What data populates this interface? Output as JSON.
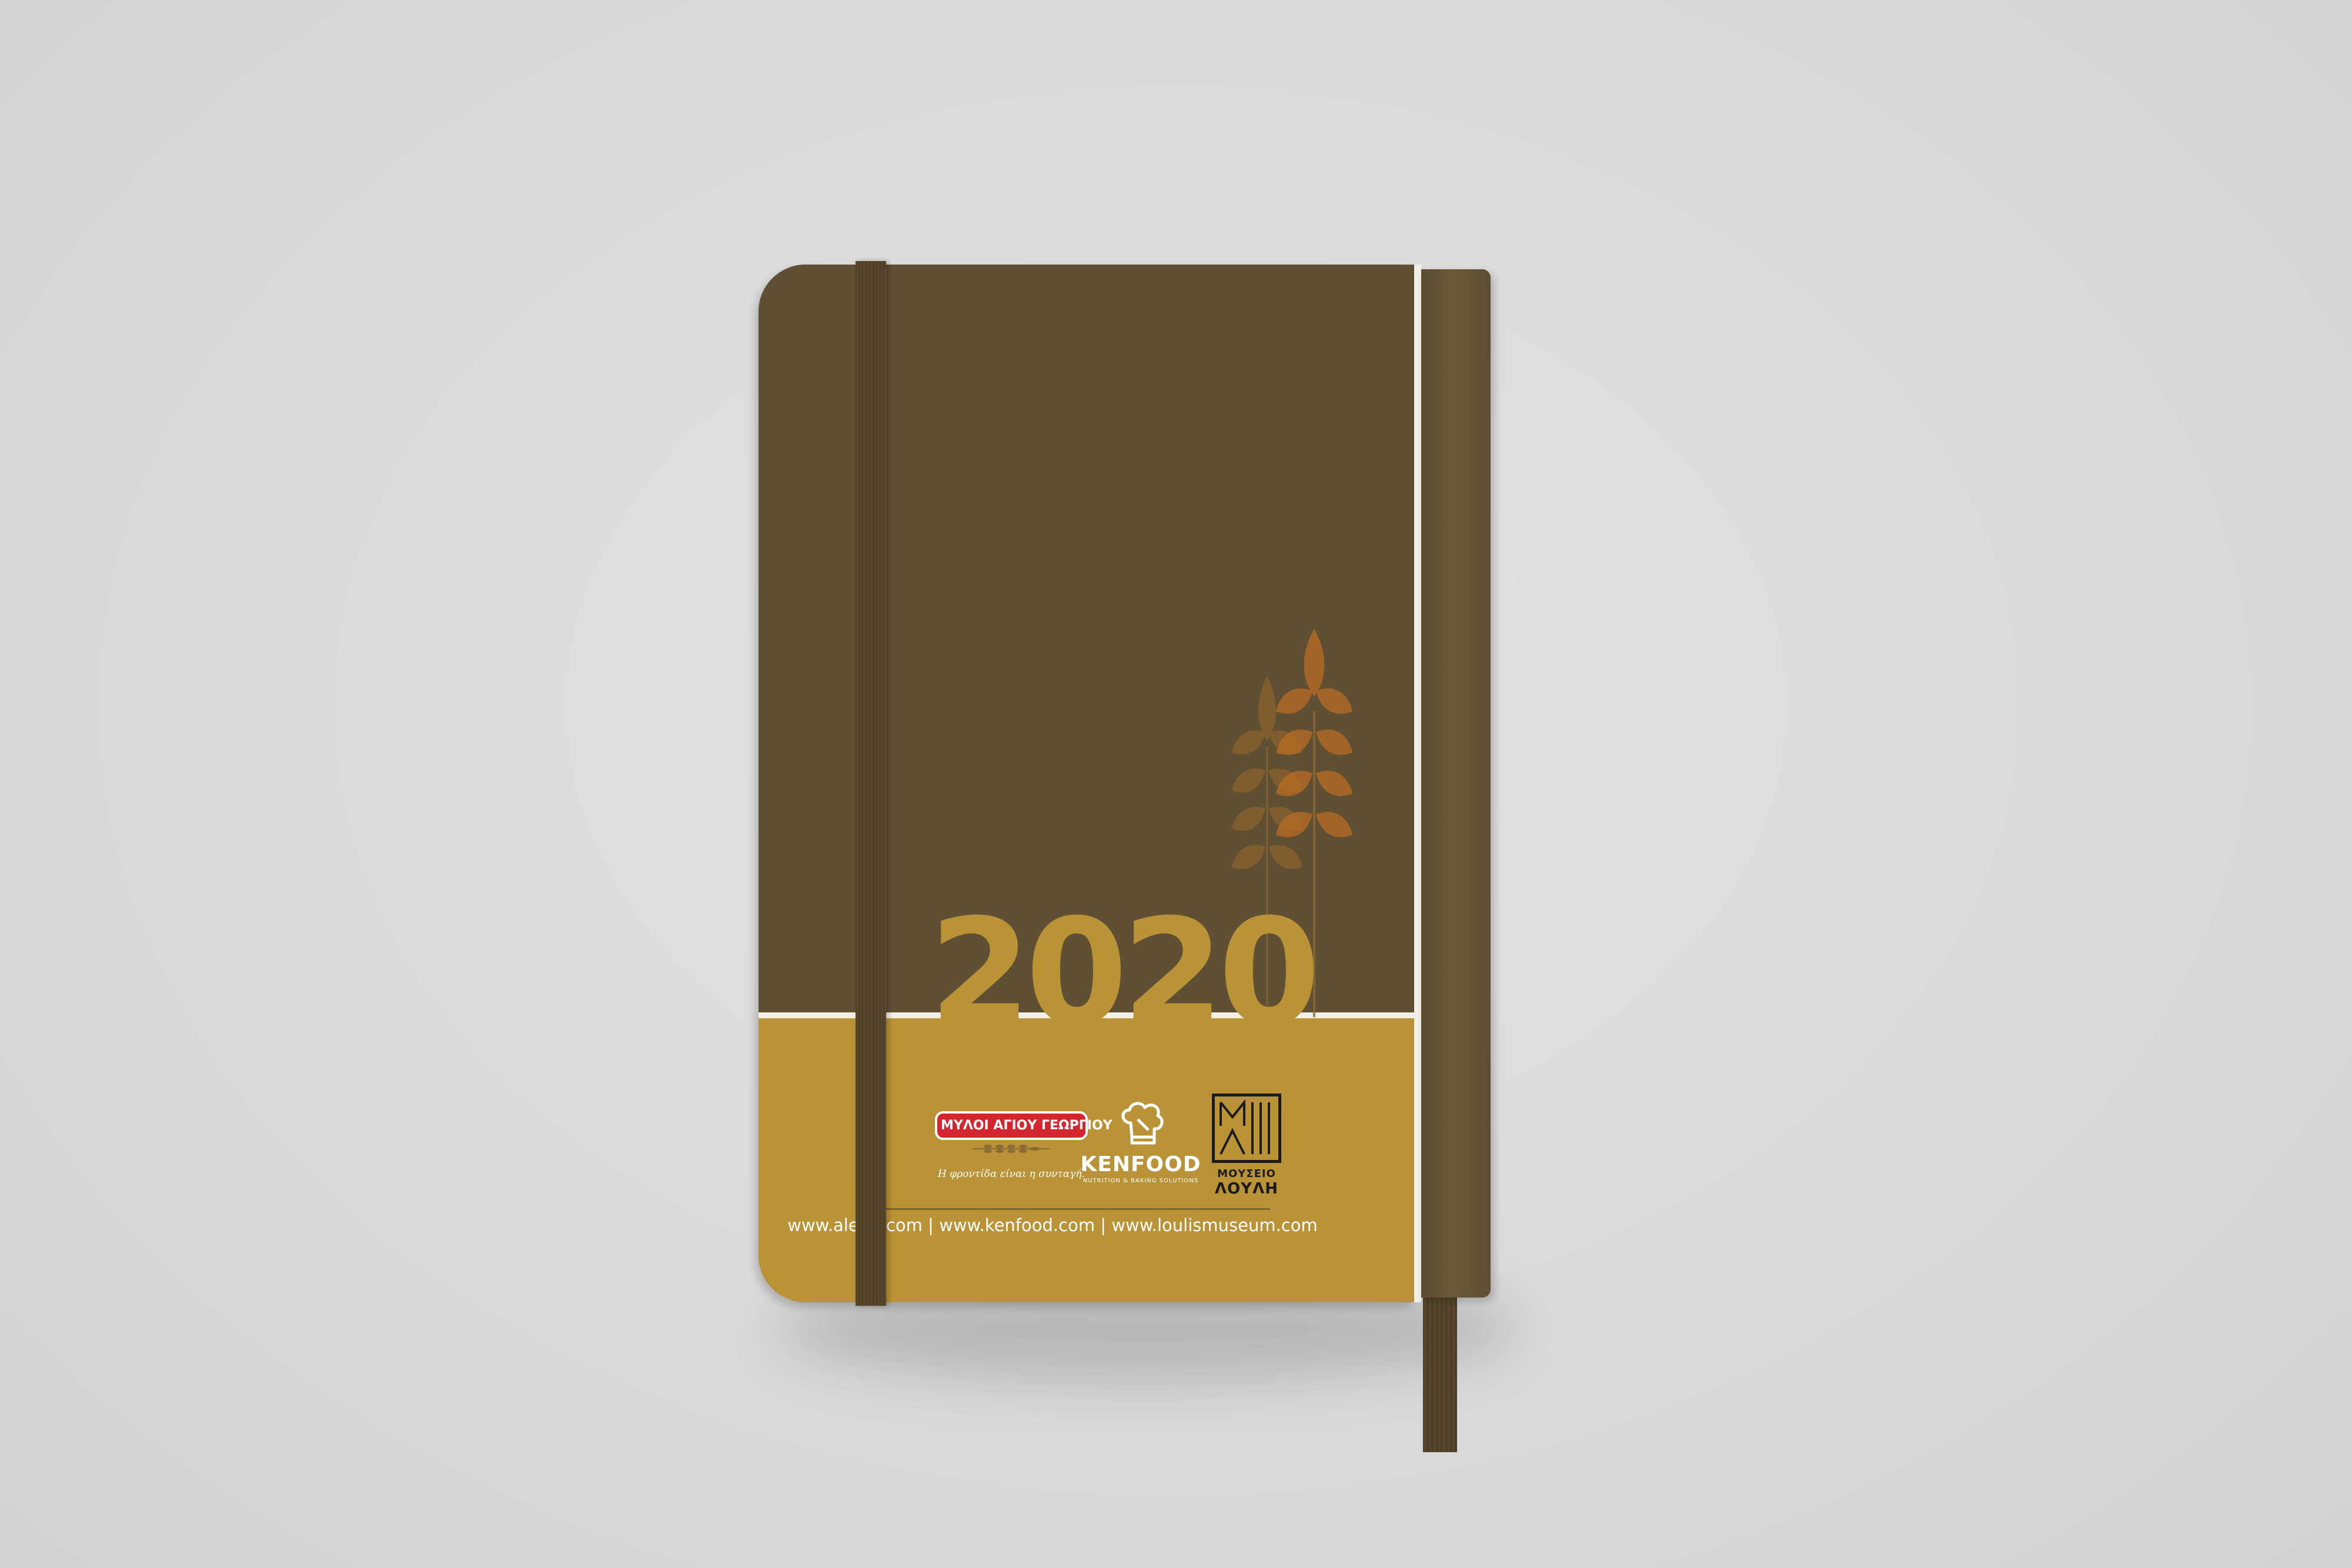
{
  "cover": {
    "year": "2020",
    "colors": {
      "cover_brown": "#5f4f33",
      "cover_gold": "#bb9337",
      "divider": "#f2efe6",
      "background": "#dcdcdc"
    }
  },
  "logos": {
    "mylo": {
      "name": "ΜΥΛΟΙ ΑΓΙΟΥ ΓΕΩΡΓΙΟΥ",
      "slogan": "Η φροντίδα είναι η συνταγή."
    },
    "kenfood": {
      "name": "KENFOOD",
      "subtitle": "NUTRITION & BAKING SOLUTIONS",
      "icon": "chef-hat-icon"
    },
    "museum": {
      "line1": "ΜΟΥΣΕΙΟ",
      "line2": "ΛΟΥΛΗ",
      "monogram": "ΜΛ"
    }
  },
  "footer": {
    "urls": "www.alevri.com | www.kenfood.com | www.loulismuseum.com"
  }
}
